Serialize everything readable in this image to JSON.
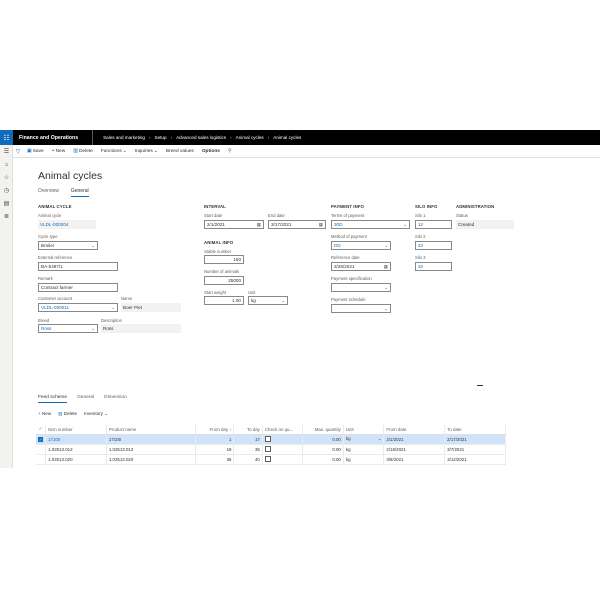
{
  "navbar": {
    "waffle_glyph": "☷",
    "app_name": "Finance and Operations",
    "breadcrumbs": [
      "Sales and marketing",
      "Setup",
      "Advanced sales logistics",
      "Animal cycles",
      "Animal cycles"
    ]
  },
  "actions": {
    "save": "Save",
    "new": "New",
    "delete": "Delete",
    "functions": "Functions",
    "inquiries": "Inquiries",
    "breed_values": "Breed values",
    "options": "Options"
  },
  "page": {
    "title": "Animal cycles",
    "tabs": [
      "Overview",
      "General"
    ]
  },
  "animal_cycle": {
    "section": "ANIMAL CYCLE",
    "animal_cycle_label": "Animal cycle",
    "animal_cycle_value": "VLDL-000004",
    "cycle_type_label": "Cycle type",
    "cycle_type_value": "Broiler",
    "external_reference_label": "External reference",
    "external_reference_value": "BA-5487/1",
    "remark_label": "Remark",
    "remark_value": "Contract farmer",
    "customer_account_label": "Customer account",
    "customer_account_value": "VLDL-000011",
    "name_label": "Name",
    "name_value": "Boer Piet",
    "breed_label": "Breed",
    "breed_value": "Ross",
    "description_label": "Description",
    "description_value": "Ross"
  },
  "interval": {
    "section": "INTERVAL",
    "start_date_label": "Start date",
    "start_date_value": "2/1/2021",
    "end_date_label": "End date",
    "end_date_value": "3/17/2021"
  },
  "animal_info": {
    "section": "ANIMAL INFO",
    "stable_number_label": "Stable number",
    "stable_number_value": "150",
    "number_of_animals_label": "Number of animals",
    "number_of_animals_value": "25000",
    "start_weight_label": "Start weight",
    "start_weight_value": "1.00",
    "unit_label": "Unit",
    "unit_value": "kg"
  },
  "payment_info": {
    "section": "PAYMENT INFO",
    "terms_label": "Terms of payment",
    "terms_value": "30D",
    "method_label": "Method of payment",
    "method_value": "DD",
    "reference_date_label": "Reference date",
    "reference_date_value": "3/28/2021",
    "specification_label": "Payment specification",
    "specification_value": "",
    "schedule_label": "Payment schedule",
    "schedule_value": ""
  },
  "silo_info": {
    "section": "SILO INFO",
    "silo1_label": "Silo 1",
    "silo1_value": "12",
    "silo2_label": "Silo 2",
    "silo2_value": "22",
    "silo3_label": "Silo 3",
    "silo3_value": "32"
  },
  "administration": {
    "section": "ADMINISTRATION",
    "status_label": "Status",
    "status_value": "Created"
  },
  "lines": {
    "tabs": [
      "Feed scheme",
      "General",
      "Dimension"
    ],
    "new": "New",
    "delete": "Delete",
    "inventory": "Inventory",
    "columns": [
      "Item number",
      "Product name",
      "From day",
      "To day",
      "Check on qu...",
      "Max. quantity",
      "Unit",
      "From date",
      "To date"
    ],
    "from_day_sort": "↑",
    "rows": [
      {
        "item": "17100",
        "product": "17100",
        "from_day": "1",
        "to_day": "17",
        "check": false,
        "max_qty": "0.00",
        "unit": "kg",
        "from_date": "2/1/2021",
        "to_date": "2/17/2021",
        "selected": true
      },
      {
        "item": "1.02513.012",
        "product": "1.02513.012",
        "from_day": "18",
        "to_day": "35",
        "check": false,
        "max_qty": "0.00",
        "unit": "kg",
        "from_date": "2/18/2021",
        "to_date": "3/7/2021",
        "selected": false
      },
      {
        "item": "1.02513.020",
        "product": "1.02513.020",
        "from_day": "36",
        "to_day": "40",
        "check": false,
        "max_qty": "0.00",
        "unit": "kg",
        "from_date": "3/8/2021",
        "to_date": "3/12/2021",
        "selected": false
      }
    ]
  },
  "colors": {
    "accent": "#0f6cbd",
    "navbar": "#000000",
    "selected_row": "#cfe4fa"
  }
}
